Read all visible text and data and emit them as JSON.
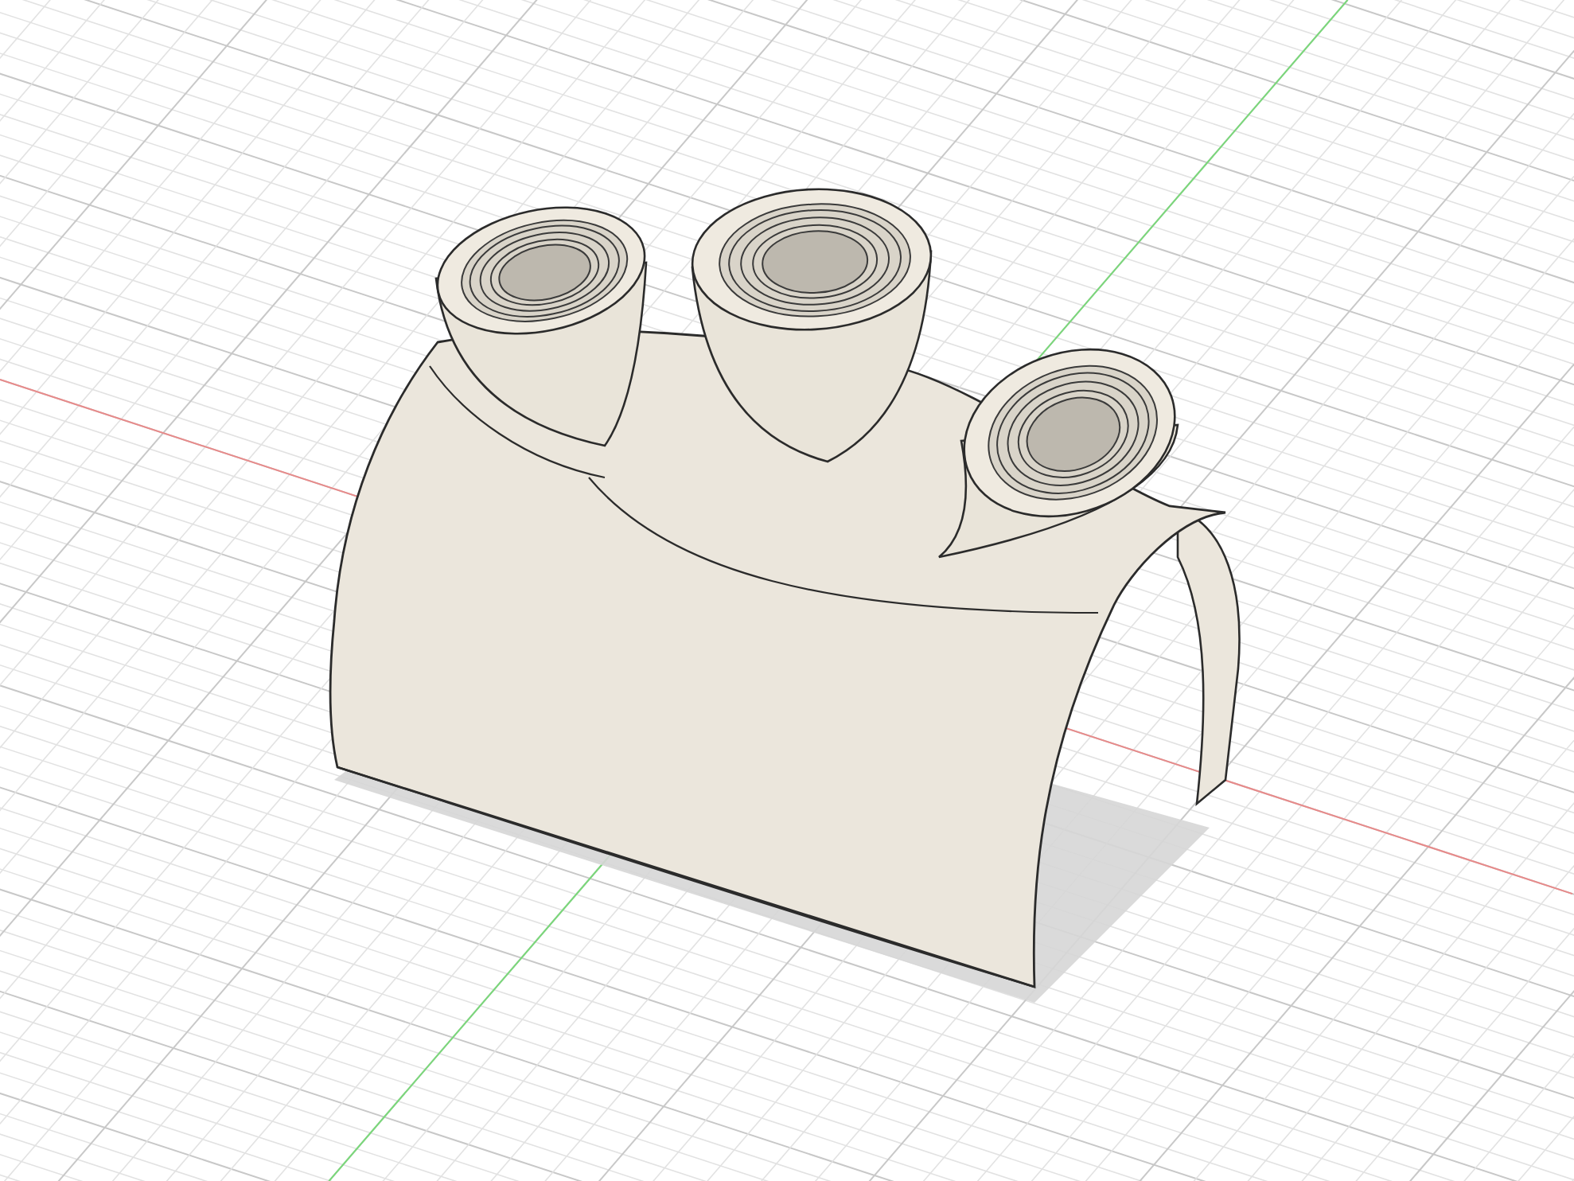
{
  "viewport": {
    "axes": [
      {
        "kind": "x",
        "color": "#e88a8a"
      },
      {
        "kind": "y",
        "color": "#7ad87a"
      }
    ]
  }
}
